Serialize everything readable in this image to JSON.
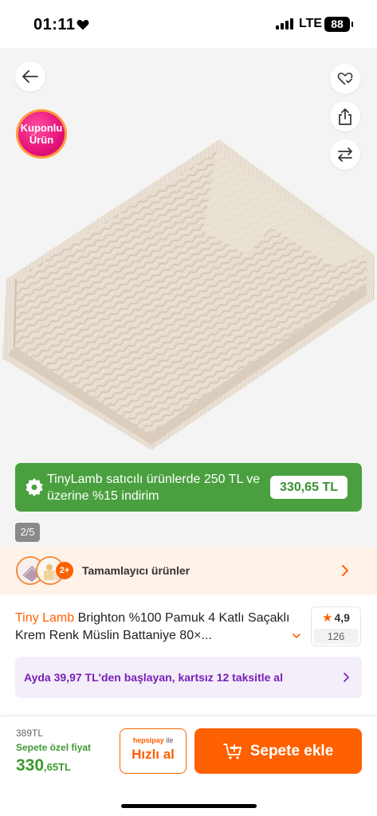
{
  "status_bar": {
    "time": "01:11",
    "network": "LTE",
    "battery": "88"
  },
  "image_area": {
    "coupon_badge": [
      "Kuponlu",
      "Ürün"
    ],
    "page_indicator": "2/5"
  },
  "promo": {
    "text": "TinyLamb satıcılı ürünlerde 250 TL ve üzerine %15 indirim",
    "price": "330,65 TL",
    "color": "#4aa03f"
  },
  "complementary": {
    "count_badge": "2+",
    "label": "Tamamlayıcı ürünler"
  },
  "product": {
    "brand": "Tiny Lamb",
    "title": "Brighton %100 Pamuk 4 Katlı Saçaklı Krem Renk Müslin Battaniye 80×...",
    "rating": "4,9",
    "review_count": "126"
  },
  "installment": {
    "text": "Ayda 39,97 TL'den başlayan, kartsız 12 taksitle al",
    "color": "#7a1fb8"
  },
  "bottom_bar": {
    "old_price": "389TL",
    "special_label": "Sepete özel fiyat",
    "price_int": "330",
    "price_dec": ",65TL",
    "quick_brand": "hepsipay",
    "quick_ile": "ile",
    "quick_label": "Hızlı al",
    "cart_label": "Sepete ekle",
    "accent_color": "#ff6000"
  }
}
